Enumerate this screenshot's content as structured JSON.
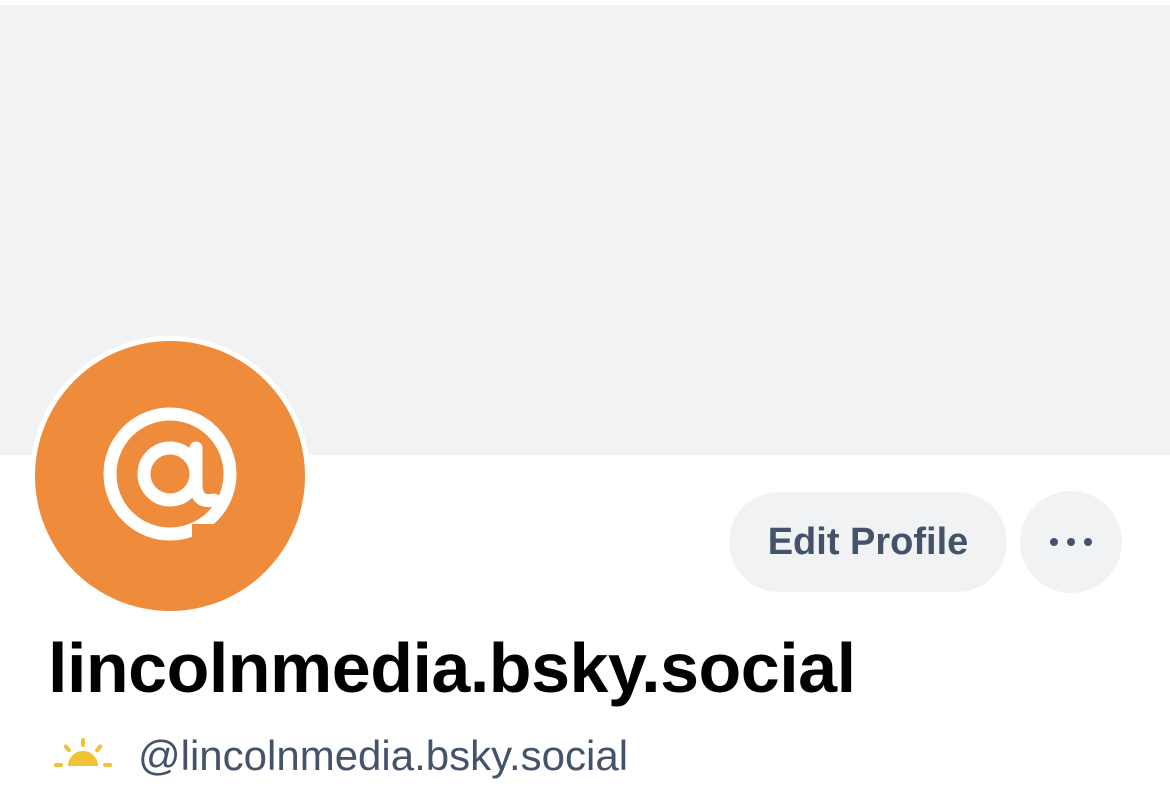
{
  "profile": {
    "display_name": "lincolnmedia.bsky.social",
    "handle": "@lincolnmedia.bsky.social",
    "avatar_color": "#ee8c3c",
    "avatar_icon": "at-sign-icon",
    "handle_icon": "sunrise-icon",
    "handle_icon_color": "#f1c232"
  },
  "actions": {
    "edit_profile_label": "Edit Profile",
    "more_icon": "more-options-icon"
  },
  "colors": {
    "banner": "#f1f2f4",
    "button_bg": "#f1f2f4",
    "button_text": "#44536a",
    "name_text": "#000000",
    "handle_text": "#44536a"
  }
}
